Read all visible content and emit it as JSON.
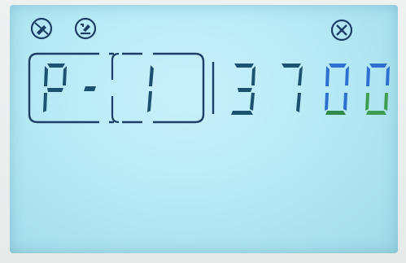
{
  "display": {
    "program_label": "P",
    "separator": "-",
    "program_number": "1",
    "value_digits": [
      "3",
      "7",
      "0",
      "0"
    ]
  },
  "icons": {
    "left_1": "no-pencil-icon",
    "left_2": "no-hammer-icon",
    "right": "settings-tool-icon"
  },
  "colors": {
    "lcd_background": "#b8ebf7",
    "segment_dark": "#1c5270",
    "segment_blue": "#2f6fd0",
    "segment_green": "#3f9d52"
  }
}
